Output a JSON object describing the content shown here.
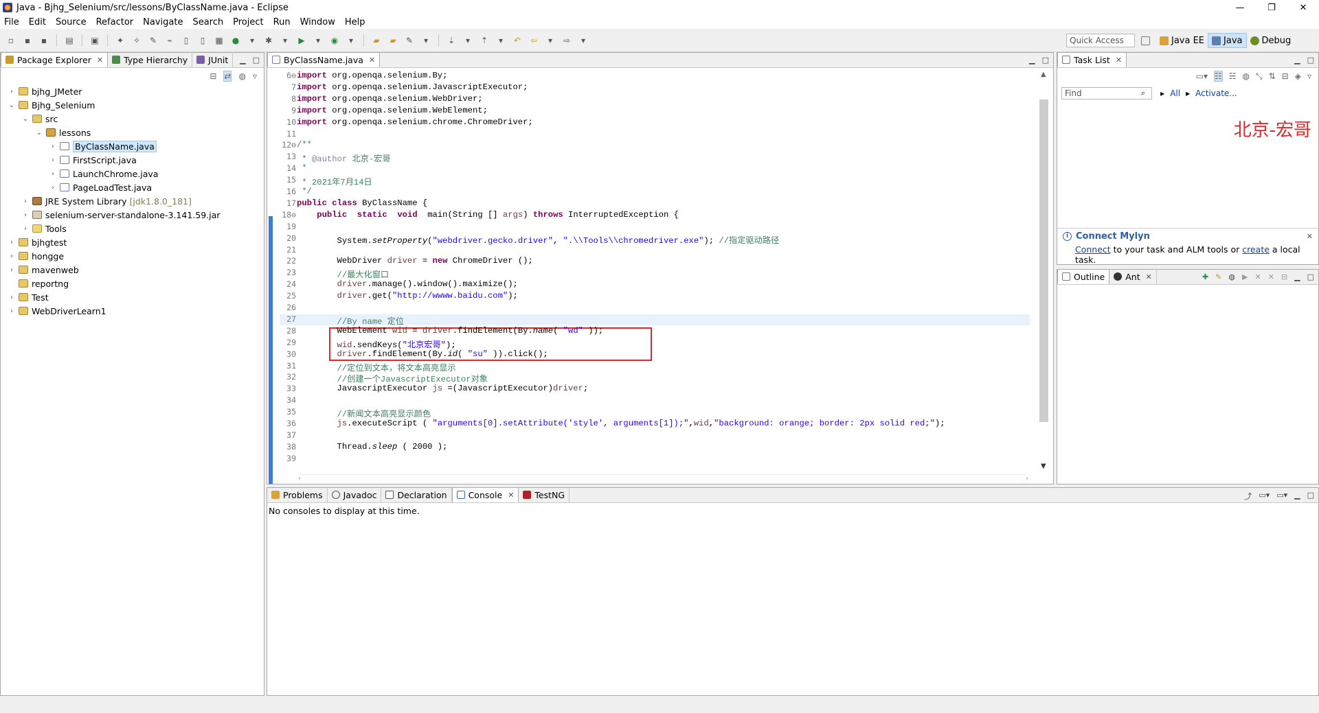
{
  "window": {
    "title": "Java - Bjhg_Selenium/src/lessons/ByClassName.java - Eclipse",
    "controls": [
      "—",
      "❐",
      "✕"
    ]
  },
  "menu": [
    "File",
    "Edit",
    "Source",
    "Refactor",
    "Navigate",
    "Search",
    "Project",
    "Run",
    "Window",
    "Help"
  ],
  "toolbar": {
    "quick_access_placeholder": "Quick Access",
    "perspectives": [
      {
        "label": "Java EE",
        "active": false
      },
      {
        "label": "Java",
        "active": true
      },
      {
        "label": "Debug",
        "active": false
      }
    ]
  },
  "package_explorer": {
    "tabs": [
      {
        "label": "Package Explorer",
        "selected": true
      },
      {
        "label": "Type Hierarchy",
        "selected": false
      },
      {
        "label": "JUnit",
        "selected": false
      }
    ],
    "tree": [
      {
        "depth": 0,
        "twisty": "›",
        "icon": "proj",
        "label": "bjhg_JMeter"
      },
      {
        "depth": 0,
        "twisty": "⌄",
        "icon": "proj",
        "label": "Bjhg_Selenium"
      },
      {
        "depth": 1,
        "twisty": "⌄",
        "icon": "src",
        "label": "src"
      },
      {
        "depth": 2,
        "twisty": "⌄",
        "icon": "pkg",
        "label": "lessons"
      },
      {
        "depth": 3,
        "twisty": "›",
        "icon": "jf",
        "label": "ByClassName.java",
        "selected": true
      },
      {
        "depth": 3,
        "twisty": "›",
        "icon": "jf",
        "label": "FirstScript.java"
      },
      {
        "depth": 3,
        "twisty": "›",
        "icon": "jf",
        "label": "LaunchChrome.java"
      },
      {
        "depth": 3,
        "twisty": "›",
        "icon": "jf",
        "label": "PageLoadTest.java"
      },
      {
        "depth": 1,
        "twisty": "›",
        "icon": "lib",
        "label": "JRE System Library",
        "suffix": "[jdk1.8.0_181]"
      },
      {
        "depth": 1,
        "twisty": "›",
        "icon": "jar",
        "label": "selenium-server-standalone-3.141.59.jar"
      },
      {
        "depth": 1,
        "twisty": "›",
        "icon": "fld",
        "label": "Tools"
      },
      {
        "depth": 0,
        "twisty": "›",
        "icon": "proj",
        "label": "bjhgtest"
      },
      {
        "depth": 0,
        "twisty": "›",
        "icon": "proj",
        "label": "hongge"
      },
      {
        "depth": 0,
        "twisty": "›",
        "icon": "proj",
        "label": "mavenweb"
      },
      {
        "depth": 0,
        "twisty": "",
        "icon": "proj",
        "label": "reportng"
      },
      {
        "depth": 0,
        "twisty": "›",
        "icon": "proj",
        "label": "Test"
      },
      {
        "depth": 0,
        "twisty": "›",
        "icon": "proj",
        "label": "WebDriverLearn1"
      }
    ]
  },
  "editor": {
    "tab_label": "ByClassName.java",
    "lines": [
      {
        "n": "6",
        "fold": "⊖",
        "html": "<span class='kw'>import</span> org.openqa.selenium.By;"
      },
      {
        "n": "7",
        "html": "<span class='kw'>import</span> org.openqa.selenium.JavascriptExecutor;"
      },
      {
        "n": "8",
        "html": "<span class='kw'>import</span> org.openqa.selenium.WebDriver;"
      },
      {
        "n": "9",
        "html": "<span class='kw'>import</span> org.openqa.selenium.WebElement;"
      },
      {
        "n": "10",
        "html": "<span class='kw'>import</span> org.openqa.selenium.chrome.ChromeDriver;"
      },
      {
        "n": "11",
        "html": ""
      },
      {
        "n": "12",
        "fold": "⊖",
        "html": "<span class='cm'>/**</span>"
      },
      {
        "n": "13",
        "html": "<span class='cm'> * <span class='ann'>@author</span> 北京-宏哥</span>"
      },
      {
        "n": "14",
        "html": "<span class='cm'> *</span>"
      },
      {
        "n": "15",
        "html": "<span class='cm'> * 2021年7月14日</span>"
      },
      {
        "n": "16",
        "html": "<span class='cm'> */</span>"
      },
      {
        "n": "17",
        "html": "<span class='kw'>public</span> <span class='kw'>class</span> ByClassName {"
      },
      {
        "n": "18",
        "fold": "⊖",
        "html": "    <span class='kw'>public</span>  <span class='kw'>static</span>  <span class='kw'>void</span>  main(String [] <span class='vr'>args</span>) <span class='kw'>throws</span> InterruptedException {"
      },
      {
        "n": "19",
        "html": ""
      },
      {
        "n": "20",
        "html": "        System.<span class='it'>setProperty</span>(<span class='st'>\"webdriver.gecko.driver\"</span>, <span class='st'>\".\\\\Tools\\\\chromedriver.exe\"</span>); <span class='cm'>//指定驱动路径</span>"
      },
      {
        "n": "21",
        "html": ""
      },
      {
        "n": "22",
        "html": "        WebDriver <span class='vr'>driver</span> = <span class='kw'>new</span> ChromeDriver ();"
      },
      {
        "n": "23",
        "html": "        <span class='cm'>//最大化窗口</span>"
      },
      {
        "n": "24",
        "html": "        <span class='vr'>driver</span>.manage().window().maximize();"
      },
      {
        "n": "25",
        "html": "        <span class='vr'>driver</span>.get(<span class='st'>\"http://wwww.baidu.com\"</span>);"
      },
      {
        "n": "26",
        "html": ""
      },
      {
        "n": "27",
        "html": "        <span class='cm'>//By name 定位</span>",
        "current": true
      },
      {
        "n": "28",
        "html": "        WebElement <span class='vr'>wid</span> = <span class='vr'>driver</span>.findElement(By.<span class='it'>name</span>( <span class='st'>\"wd\"</span> ));"
      },
      {
        "n": "29",
        "html": "        <span class='vr'>wid</span>.sendKeys(<span class='st'>\"北京宏哥\"</span>);"
      },
      {
        "n": "30",
        "html": "        <span class='vr'>driver</span>.findElement(By.<span class='it'>id</span>( <span class='st'>\"su\"</span> )).click();"
      },
      {
        "n": "31",
        "html": "        <span class='cm'>//定位到文本，将文本高亮显示</span>"
      },
      {
        "n": "32",
        "html": "        <span class='cm'>//创建一个JavascriptExecutor对象</span>"
      },
      {
        "n": "33",
        "html": "        JavascriptExecutor <span class='vr'>js</span> =(JavascriptExecutor)<span class='vr'>driver</span>;"
      },
      {
        "n": "34",
        "html": ""
      },
      {
        "n": "35",
        "html": "        <span class='cm'>//新闻文本高亮显示颜色</span>"
      },
      {
        "n": "36",
        "html": "        <span class='vr'>js</span>.executeScript ( <span class='st'>\"arguments[0].setAttribute('style', arguments[1]);\"</span>,<span class='vr'>wid</span>,<span class='st'>\"background: orange; border: 2px solid red;\"</span>);"
      },
      {
        "n": "37",
        "html": ""
      },
      {
        "n": "38",
        "html": "        Thread.<span class='it'>sleep</span> ( 2000 );"
      },
      {
        "n": "39",
        "html": ""
      }
    ]
  },
  "task_list": {
    "tab_label": "Task List",
    "find_placeholder": "Find",
    "all_label": "All",
    "activate_label": "Activate...",
    "watermark": "北京-宏哥",
    "mylyn": {
      "title": "Connect Mylyn",
      "connect": "Connect",
      "text1": " to your task and ALM tools or ",
      "create": "create",
      "text2": " a local task."
    }
  },
  "outline": {
    "tabs": [
      {
        "label": "Outline",
        "selected": true
      },
      {
        "label": "Ant",
        "selected": false
      }
    ]
  },
  "bottom": {
    "tabs": [
      {
        "label": "Problems",
        "selected": false
      },
      {
        "label": "Javadoc",
        "selected": false
      },
      {
        "label": "Declaration",
        "selected": false
      },
      {
        "label": "Console",
        "selected": true
      },
      {
        "label": "TestNG",
        "selected": false
      }
    ],
    "console_message": "No consoles to display at this time."
  }
}
